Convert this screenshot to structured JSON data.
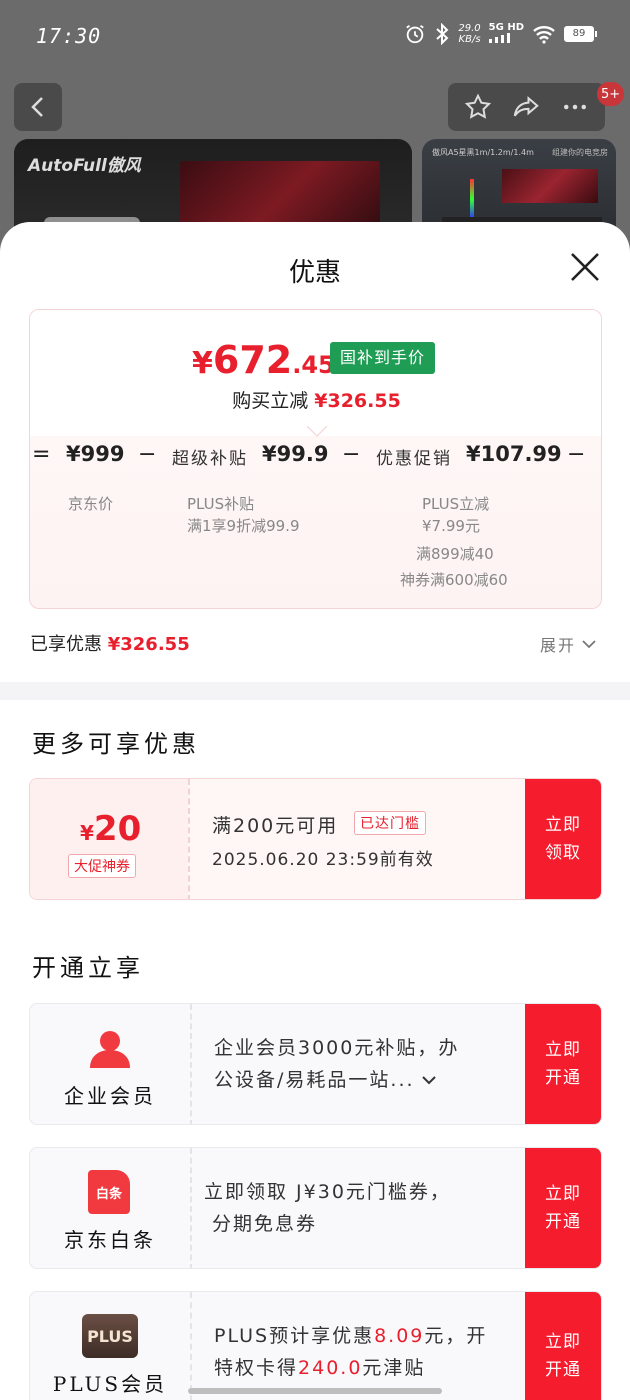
{
  "status_bar": {
    "time": "17:30",
    "speed_top": "29.0",
    "speed_bottom": "KB/s",
    "network": "5G HD",
    "battery": "89"
  },
  "background": {
    "badge": "5+",
    "brand": "AutoFull傲风",
    "thumb_text": "傲风A5星黑1m/1.2m/1.4m",
    "thumb_text2": "组建你的电竞房"
  },
  "sheet": {
    "title": "优惠",
    "price": {
      "yen": "¥",
      "int": "672",
      "dec": ".45"
    },
    "gov_tag": "国补到手价",
    "buy_label": "购买立减",
    "buy_amount": "¥326.55",
    "formula": {
      "eq": "=",
      "jd_price": "¥999",
      "minus1": "−",
      "subsidy_label": "超级补贴",
      "subsidy_value": "¥99.9",
      "minus2": "−",
      "promo_label": "优惠促销",
      "promo_value": "¥107.99",
      "minus3": "−"
    },
    "sub": {
      "jd_price_label": "京东价",
      "plus_subsidy": "PLUS补贴",
      "plus_subsidy_detail": "满1享9折减99.9",
      "plus_discount": "PLUS立减",
      "plus_discount_detail": "¥7.99元",
      "full_reduction": "满899减40",
      "coupon_reduction": "神券满600减60"
    },
    "enjoyed_label": "已享优惠",
    "enjoyed_amount": "¥326.55",
    "expand_label": "展开",
    "more_title": "更多可享优惠",
    "coupon": {
      "yen": "¥",
      "amount": "20",
      "type": "大促神券",
      "condition": "满200元可用",
      "reached": "已达门槛",
      "valid": "2025.06.20 23:59前有效",
      "cta_line1": "立即",
      "cta_line2": "领取"
    },
    "open_title": "开通立享",
    "memberships": [
      {
        "name": "企业会员",
        "desc1": "企业会员3000元补贴，办",
        "desc2": "公设备/易耗品一站...",
        "cta_line1": "立即",
        "cta_line2": "开通"
      },
      {
        "name": "京东白条",
        "icon_text": "白条",
        "desc1": "立即领取 J¥30元门槛券，",
        "desc2": "分期免息券",
        "cta_line1": "立即",
        "cta_line2": "开通"
      },
      {
        "name": "PLUS会员",
        "icon_text": "PLUS",
        "desc_pre": "PLUS预计享优惠",
        "desc_hl1": "8.09",
        "desc_mid": "元，开",
        "desc2_pre": "特权卡得",
        "desc_hl2": "240.0",
        "desc2_post": "元津贴",
        "cta_line1": "立即",
        "cta_line2": "开通"
      }
    ]
  },
  "colors": {
    "accent_red": "#e8202e",
    "cta_red": "#f51c2e",
    "gov_green": "#1f9d55"
  }
}
